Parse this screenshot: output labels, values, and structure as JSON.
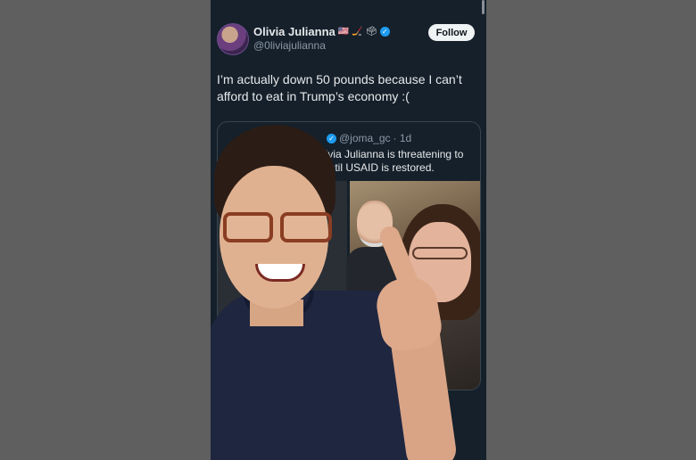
{
  "tweet": {
    "display_name": "Olivia Julianna",
    "name_emojis": "🇺🇸 🏒 🗳",
    "handle": "@0liviajulianna",
    "follow_label": "Follow",
    "text": "I’m actually down 50 pounds because I can’t afford to eat in Trump’s economy :("
  },
  "quote": {
    "handle": "@joma_gc",
    "age": "· 1d",
    "text": "livia Julianna is threatening to until USAID is restored."
  },
  "colors": {
    "background": "#15202b",
    "accent": "#1d9bf0",
    "text": "#e7e9ea",
    "muted": "#8b98a5"
  },
  "icons": [
    "verified-icon",
    "views-icon",
    "share-icon"
  ]
}
